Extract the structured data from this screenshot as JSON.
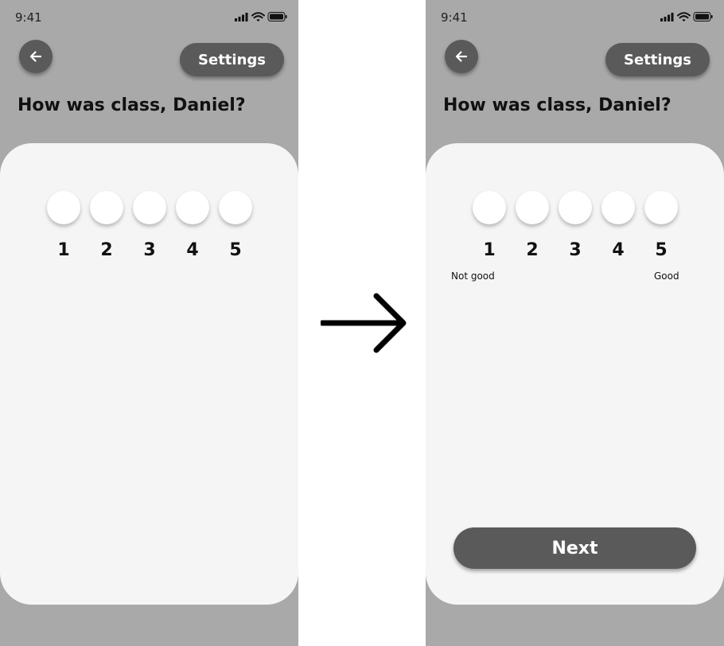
{
  "screens": [
    {
      "status_time": "9:41",
      "settings_label": "Settings",
      "question": "How was class, Daniel?",
      "ratings": [
        "1",
        "2",
        "3",
        "4",
        "5"
      ]
    },
    {
      "status_time": "9:41",
      "settings_label": "Settings",
      "question": "How was class, Daniel?",
      "ratings": [
        "1",
        "2",
        "3",
        "4",
        "5"
      ],
      "scale_low_label": "Not good",
      "scale_high_label": "Good",
      "next_label": "Next"
    }
  ],
  "icons": {
    "back": "arrow-left-icon",
    "signal": "cellular-signal-icon",
    "wifi": "wifi-icon",
    "battery": "battery-icon",
    "transition": "arrow-right-icon"
  },
  "colors": {
    "phone_background": "#a9a9a9",
    "card_background": "#f5f5f5",
    "button_fill": "#5a5a5a",
    "button_text": "#ffffff",
    "circle_fill": "#ffffff"
  }
}
